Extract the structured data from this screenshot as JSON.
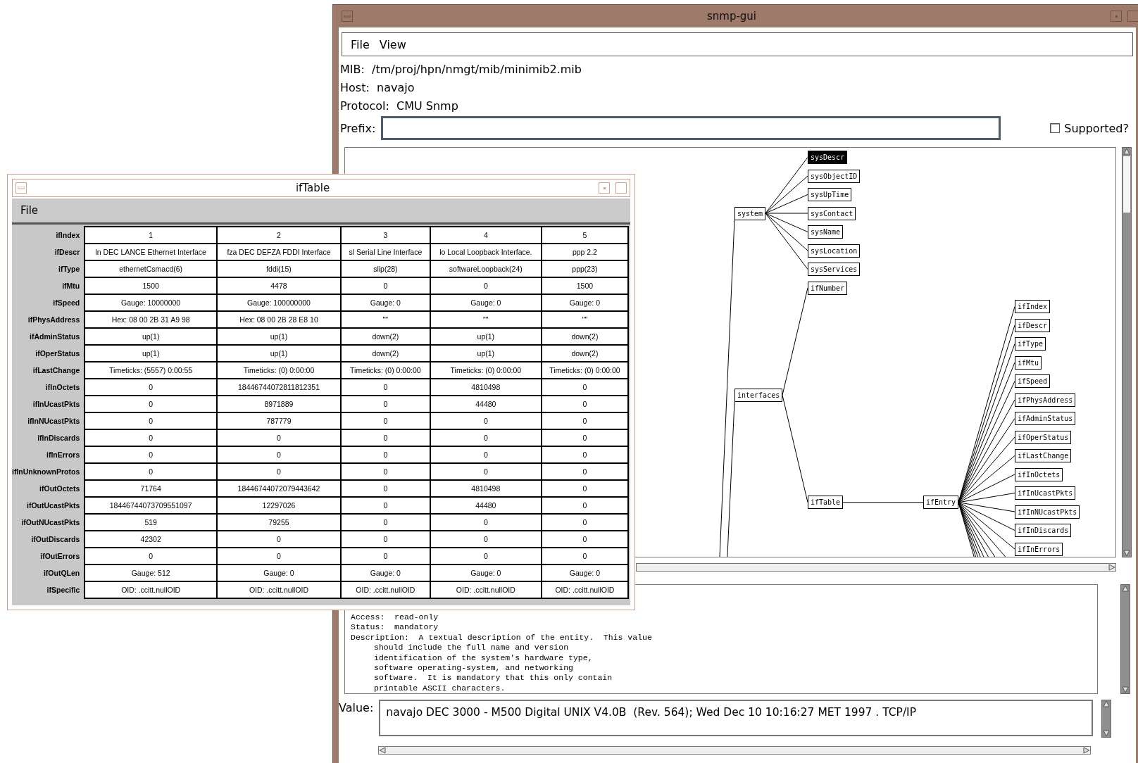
{
  "main_window": {
    "title": "snmp-gui",
    "menu": [
      {
        "label": "File"
      },
      {
        "label": "View"
      }
    ],
    "info": [
      {
        "label": "MIB:",
        "value": "/tm/proj/hpn/nmgt/mib/minimib2.mib"
      },
      {
        "label": "Host:",
        "value": "navajo"
      },
      {
        "label": "Protocol:",
        "value": "CMU Snmp"
      }
    ],
    "prefix": {
      "label": "Prefix:"
    },
    "supported": {
      "label": "Supported?",
      "checked": false
    },
    "mib_tree": [
      {
        "label": "system",
        "selected": false,
        "children": [
          {
            "label": "sysDescr",
            "selected": true
          },
          {
            "label": "sysObjectID",
            "selected": false
          },
          {
            "label": "sysUpTime",
            "selected": false
          },
          {
            "label": "sysContact",
            "selected": false
          },
          {
            "label": "sysName",
            "selected": false
          },
          {
            "label": "sysLocation",
            "selected": false
          },
          {
            "label": "sysServices",
            "selected": false
          }
        ]
      },
      {
        "label": "interfaces",
        "selected": false,
        "children": [
          {
            "label": "ifNumber",
            "selected": false
          },
          {
            "label": "ifTable",
            "selected": false,
            "children": [
              {
                "label": "ifEntry",
                "selected": false,
                "children": [
                  {
                    "label": "ifIndex",
                    "selected": false
                  },
                  {
                    "label": "ifDescr",
                    "selected": false
                  },
                  {
                    "label": "ifType",
                    "selected": false
                  },
                  {
                    "label": "ifMtu",
                    "selected": false
                  },
                  {
                    "label": "ifSpeed",
                    "selected": false
                  },
                  {
                    "label": "ifPhysAddress",
                    "selected": false
                  },
                  {
                    "label": "ifAdminStatus",
                    "selected": false
                  },
                  {
                    "label": "ifOperStatus",
                    "selected": false
                  },
                  {
                    "label": "ifLastChange",
                    "selected": false
                  },
                  {
                    "label": "ifInOctets",
                    "selected": false
                  },
                  {
                    "label": "ifInUcastPkts",
                    "selected": false
                  },
                  {
                    "label": "ifInNUcastPkts",
                    "selected": false
                  },
                  {
                    "label": "ifInDiscards",
                    "selected": false
                  },
                  {
                    "label": "ifInErrors",
                    "selected": false
                  }
                ]
              }
            ]
          }
        ]
      }
    ],
    "description_lines": [
      {
        "text": "Access:  read-only",
        "indent": false
      },
      {
        "text": "Status:  mandatory",
        "indent": false
      },
      {
        "text": "Description:  A textual description of the entity.  This value",
        "indent": false
      },
      {
        "text": "should include the full name and version",
        "indent": true
      },
      {
        "text": "identification of the system's hardware type,",
        "indent": true
      },
      {
        "text": "software operating-system, and networking",
        "indent": true
      },
      {
        "text": "software.  It is mandatory that this only contain",
        "indent": true
      },
      {
        "text": "printable ASCII characters.",
        "indent": true
      }
    ],
    "value": {
      "label": "Value:",
      "text": "navajo DEC 3000 - M500 Digital UNIX V4.0B  (Rev. 564); Wed Dec 10 10:16:27 MET 1997 . TCP/IP"
    }
  },
  "table_window": {
    "title": "ifTable",
    "menu": [
      {
        "label": "File"
      }
    ],
    "rows": [
      {
        "label": "ifIndex",
        "cells": [
          "1",
          "2",
          "3",
          "4",
          "5"
        ]
      },
      {
        "label": "ifDescr",
        "cells": [
          "ln DEC LANCE Ethernet Interface",
          "fza DEC DEFZA FDDI Interface",
          "sl Serial Line Interface",
          "lo Local Loopback Interface.",
          "ppp 2.2"
        ]
      },
      {
        "label": "ifType",
        "cells": [
          "ethernetCsmacd(6)",
          "fddi(15)",
          "slip(28)",
          "softwareLoopback(24)",
          "ppp(23)"
        ]
      },
      {
        "label": "ifMtu",
        "cells": [
          "1500",
          "4478",
          "0",
          "0",
          "1500"
        ]
      },
      {
        "label": "ifSpeed",
        "cells": [
          "Gauge: 10000000",
          "Gauge: 100000000",
          "Gauge: 0",
          "Gauge: 0",
          "Gauge: 0"
        ]
      },
      {
        "label": "ifPhysAddress",
        "cells": [
          "Hex: 08 00 2B 31 A9 98",
          "Hex: 08 00 2B 28 E8 10",
          "\"\"",
          "\"\"",
          "\"\""
        ]
      },
      {
        "label": "ifAdminStatus",
        "cells": [
          "up(1)",
          "up(1)",
          "down(2)",
          "up(1)",
          "down(2)"
        ]
      },
      {
        "label": "ifOperStatus",
        "cells": [
          "up(1)",
          "up(1)",
          "down(2)",
          "up(1)",
          "down(2)"
        ]
      },
      {
        "label": "ifLastChange",
        "cells": [
          "Timeticks: (5557) 0:00:55",
          "Timeticks: (0) 0:00:00",
          "Timeticks: (0) 0:00:00",
          "Timeticks: (0) 0:00:00",
          "Timeticks: (0) 0:00:00"
        ]
      },
      {
        "label": "ifInOctets",
        "cells": [
          "0",
          "18446744072811812351",
          "0",
          "4810498",
          "0"
        ]
      },
      {
        "label": "ifInUcastPkts",
        "cells": [
          "0",
          "8971889",
          "0",
          "44480",
          "0"
        ]
      },
      {
        "label": "ifInNUcastPkts",
        "cells": [
          "0",
          "787779",
          "0",
          "0",
          "0"
        ]
      },
      {
        "label": "ifInDiscards",
        "cells": [
          "0",
          "0",
          "0",
          "0",
          "0"
        ]
      },
      {
        "label": "ifInErrors",
        "cells": [
          "0",
          "0",
          "0",
          "0",
          "0"
        ]
      },
      {
        "label": "ifInUnknownProtos",
        "cells": [
          "0",
          "0",
          "0",
          "0",
          "0"
        ]
      },
      {
        "label": "ifOutOctets",
        "cells": [
          "71764",
          "18446744072079443642",
          "0",
          "4810498",
          "0"
        ]
      },
      {
        "label": "ifOutUcastPkts",
        "cells": [
          "18446744073709551097",
          "12297026",
          "0",
          "44480",
          "0"
        ]
      },
      {
        "label": "ifOutNUcastPkts",
        "cells": [
          "519",
          "79255",
          "0",
          "0",
          "0"
        ]
      },
      {
        "label": "ifOutDiscards",
        "cells": [
          "42302",
          "0",
          "0",
          "0",
          "0"
        ]
      },
      {
        "label": "ifOutErrors",
        "cells": [
          "0",
          "0",
          "0",
          "0",
          "0"
        ]
      },
      {
        "label": "ifOutQLen",
        "cells": [
          "Gauge: 512",
          "Gauge: 0",
          "Gauge: 0",
          "Gauge: 0",
          "Gauge: 0"
        ]
      },
      {
        "label": "ifSpecific",
        "cells": [
          "OID: .ccitt.nullOID",
          "OID: .ccitt.nullOID",
          "OID: .ccitt.nullOID",
          "OID: .ccitt.nullOID",
          "OID: .ccitt.nullOID"
        ]
      }
    ]
  }
}
